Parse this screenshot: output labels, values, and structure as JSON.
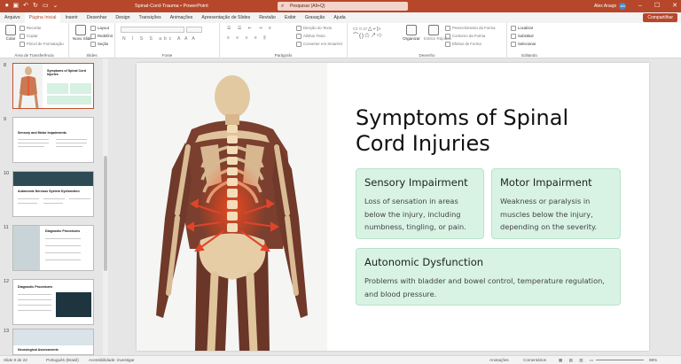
{
  "titlebar": {
    "doc_title": "Spinal-Cord-Trauma  •  PowerPoint",
    "search_placeholder": "Pesquisar (Alt+Q)",
    "user_name": "Alex Araujo",
    "user_initials": "AA"
  },
  "tabs": [
    "Arquivo",
    "Página Inicial",
    "Inserir",
    "Desenhar",
    "Design",
    "Transições",
    "Animações",
    "Apresentação de Slides",
    "Revisão",
    "Exibir",
    "Gravação",
    "Ajuda"
  ],
  "active_tab": "Página Inicial",
  "share_label": "Compartilhar",
  "ribbon": {
    "clipboard": {
      "paste": "Colar",
      "cut": "Recortar",
      "copy": "Copiar",
      "format_painter": "Pincel de Formatação",
      "label": "Área de Transferência"
    },
    "slides": {
      "new_slide": "Novo Slide",
      "layout": "Layout",
      "reset": "Redefinir",
      "section": "Seção",
      "label": "Slides"
    },
    "font": {
      "label": "Fonte"
    },
    "paragraph": {
      "text_direction": "Direção do Texto",
      "align_text": "Alinhar Texto",
      "smartart": "Converter em SmartArt",
      "label": "Parágrafo"
    },
    "drawing": {
      "arrange": "Organizar",
      "quick_styles": "Estilos Rápidos",
      "shape_fill": "Preenchimento da Forma",
      "shape_outline": "Contorno da Forma",
      "shape_effects": "Efeitos de Forma",
      "label": "Desenho"
    },
    "editing": {
      "find": "Localizar",
      "replace": "Substituir",
      "select": "Selecionar",
      "label": "Editando"
    }
  },
  "thumbnails": [
    {
      "num": "8",
      "title": "Symptoms of Spinal Cord Injuries"
    },
    {
      "num": "9",
      "title": "Sensory and Motor Impairments"
    },
    {
      "num": "10",
      "title": "Autonomic Nervous System Dysfunction"
    },
    {
      "num": "11",
      "title": "Diagnostic Procedures"
    },
    {
      "num": "12",
      "title": "Diagnostic Procedures"
    },
    {
      "num": "13",
      "title": "Neurological Assessments"
    }
  ],
  "slide": {
    "title": "Symptoms of Spinal Cord Injuries",
    "cards": [
      {
        "heading": "Sensory Impairment",
        "body": "Loss of sensation in areas below the injury, including numbness, tingling, or pain."
      },
      {
        "heading": "Motor Impairment",
        "body": "Weakness or paralysis in muscles below the injury, depending on the severity."
      },
      {
        "heading": "Autonomic Dysfunction",
        "body": "Problems with bladder and bowel control, temperature regulation, and blood pressure."
      }
    ]
  },
  "status": {
    "slide_of": "Slide 8 de 22",
    "language": "Português (Brasil)",
    "accessibility": "Acessibilidade: investigar",
    "notes": "Anotações",
    "comments": "Comentários",
    "zoom": "98%"
  },
  "colors": {
    "accent": "#b7472a",
    "card_bg": "#d8f3e4",
    "card_border": "#b9e3cb"
  }
}
